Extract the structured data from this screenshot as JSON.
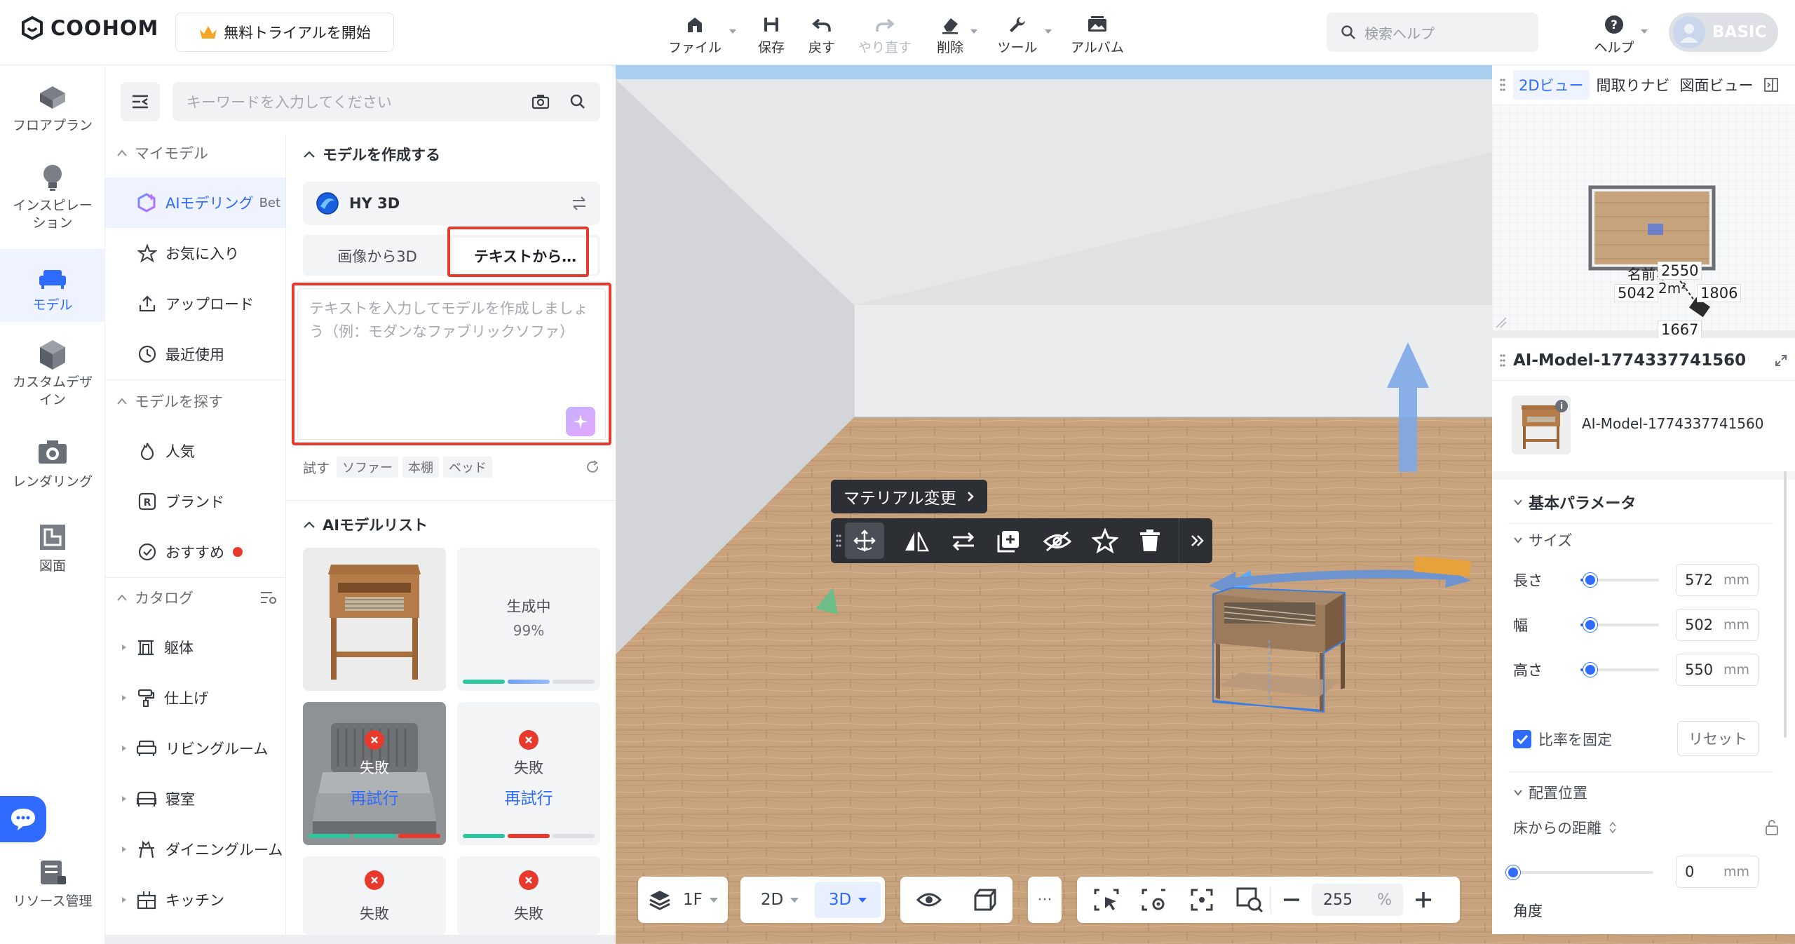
{
  "app": {
    "logo": "COOHOM",
    "trial_button": "無料トライアルを開始",
    "plan_badge": "BASIC"
  },
  "toolbar": {
    "file": "ファイル",
    "save": "保存",
    "undo": "戻す",
    "redo": "やり直す",
    "delete": "削除",
    "tools": "ツール",
    "album": "アルバム",
    "help_search_placeholder": "検索ヘルプ",
    "help": "ヘルプ"
  },
  "left_rail": {
    "floorplan": "フロアプラン",
    "inspiration": "インスピレーション",
    "model": "モデル",
    "custom_design": "カスタムデザイン",
    "rendering": "レンダリング",
    "drawing": "図面",
    "resource_mgmt": "リソース管理"
  },
  "panel": {
    "search_placeholder": "キーワードを入力してください",
    "my_models": {
      "header": "マイモデル",
      "ai_modeling": "AIモデリング",
      "beta": "Bet",
      "favorites": "お気に入り",
      "upload": "アップロード",
      "recent": "最近使用"
    },
    "find_models": {
      "header": "モデルを探す",
      "popular": "人気",
      "brands": "ブランド",
      "recommended": "おすすめ"
    },
    "catalog": {
      "header": "カタログ",
      "items": [
        "躯体",
        "仕上げ",
        "リビングルーム",
        "寝室",
        "ダイニングルーム",
        "キッチン"
      ]
    },
    "create": {
      "header": "モデルを作成する",
      "engine": "HY 3D",
      "tab_image": "画像から3D",
      "tab_text": "テキストから…",
      "prompt_placeholder": "テキストを入力してモデルを作成しましょう（例：モダンなファブリックソファ）",
      "try_label": "試す",
      "try_tags": [
        "ソファー",
        "本棚",
        "ベッド"
      ]
    },
    "ai_list": {
      "header": "AIモデルリスト",
      "generating": "生成中",
      "progress": "99%",
      "failed": "失敗",
      "retry": "再試行"
    }
  },
  "viewport": {
    "material_change": "マテリアル変更",
    "floor_label": "1F",
    "view_2d": "2D",
    "view_3d": "3D",
    "zoom_value": "255",
    "zoom_unit": "%"
  },
  "minimap": {
    "tabs": [
      "2Dビュー",
      "間取りナビ",
      "図面ビュー"
    ],
    "dims": {
      "top": "2550",
      "left": "5042",
      "right": "1806",
      "bottom": "1667",
      "room_name": "名前なし",
      "area": "2m²"
    }
  },
  "properties": {
    "title": "AI-Model-1774337741560",
    "model_name": "AI-Model-1774337741560",
    "basic_params": "基本パラメータ",
    "size_header": "サイズ",
    "length_label": "長さ",
    "length": "572",
    "width_label": "幅",
    "width": "502",
    "height_label": "高さ",
    "height": "550",
    "unit": "mm",
    "lock_ratio": "比率を固定",
    "reset": "リセット",
    "placement": "配置位置",
    "floor_distance": "床からの距離",
    "floor_distance_value": "0",
    "angle": "角度"
  },
  "colors": {
    "accent": "#2f6bff",
    "highlight_red": "#e8392d",
    "toolbar_dark": "#2c2f34"
  }
}
